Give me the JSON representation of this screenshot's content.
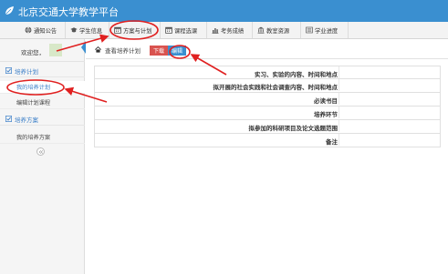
{
  "header": {
    "title": "北京交通大学教学平台",
    "logo_icon": "leaf-logo-icon"
  },
  "nav": {
    "items": [
      {
        "label": "通知公告",
        "icon": "globe-icon"
      },
      {
        "label": "学生信息",
        "icon": "graduation-cap-icon"
      },
      {
        "label": "方案与计划",
        "icon": "calendar-icon"
      },
      {
        "label": "课程选课",
        "icon": "calendar-icon"
      },
      {
        "label": "考务成绩",
        "icon": "bar-chart-icon"
      },
      {
        "label": "教室资源",
        "icon": "bank-icon"
      },
      {
        "label": "学业进度",
        "icon": "list-icon"
      }
    ]
  },
  "sidebar": {
    "welcome": "欢迎您，",
    "groups": [
      {
        "label": "培养计划",
        "items": [
          "我的培养计划",
          "编辑计划课程"
        ]
      },
      {
        "label": "培养方案",
        "items": [
          "我的培养方案"
        ]
      }
    ],
    "collapse_icon": "double-chevron-left-icon"
  },
  "main": {
    "breadcrumb": "查看培养计划",
    "download_label": "下载",
    "edit_label": "编辑",
    "rows": [
      "实习、实验的内容、时间和地点",
      "拟开展的社会实践和社会调查内容、时间和地点",
      "必读书目",
      "培养环节",
      "拟参加的科研项目及论文选题范围",
      "备注"
    ]
  },
  "colors": {
    "titlebar": "#3a8fd0",
    "accent": "#3a7ec8",
    "download_button": "#d9534f",
    "annotation": "#e02020"
  }
}
